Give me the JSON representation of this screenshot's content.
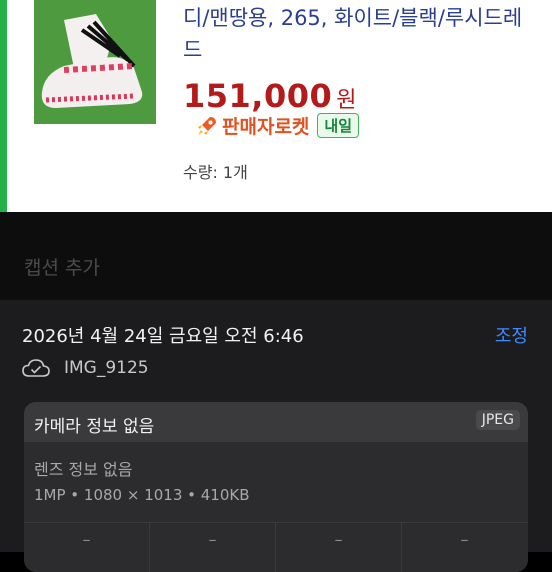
{
  "product": {
    "title": "디/맨땅용, 265, 화이트/블랙/루시드레드",
    "price": "151,000",
    "currency": "원",
    "delivery_badge": "판매자로켓",
    "tomorrow_badge": "내일",
    "quantity": "수량: 1개"
  },
  "caption": {
    "placeholder": "캡션 추가"
  },
  "info": {
    "datetime": "2026년 4월 24일 금요일 오전 6:46",
    "adjust_label": "조정",
    "filename": "IMG_9125",
    "camera": "카메라 정보 없음",
    "format": "JPEG",
    "lens": "렌즈 정보 없음",
    "specs": "1MP • 1080 × 1013 • 410KB",
    "exif": [
      "–",
      "–",
      "–",
      "–"
    ]
  },
  "colors": {
    "brand_green": "#25b14a",
    "price_red": "#b31b1b",
    "accent_blue": "#3d8bff"
  }
}
